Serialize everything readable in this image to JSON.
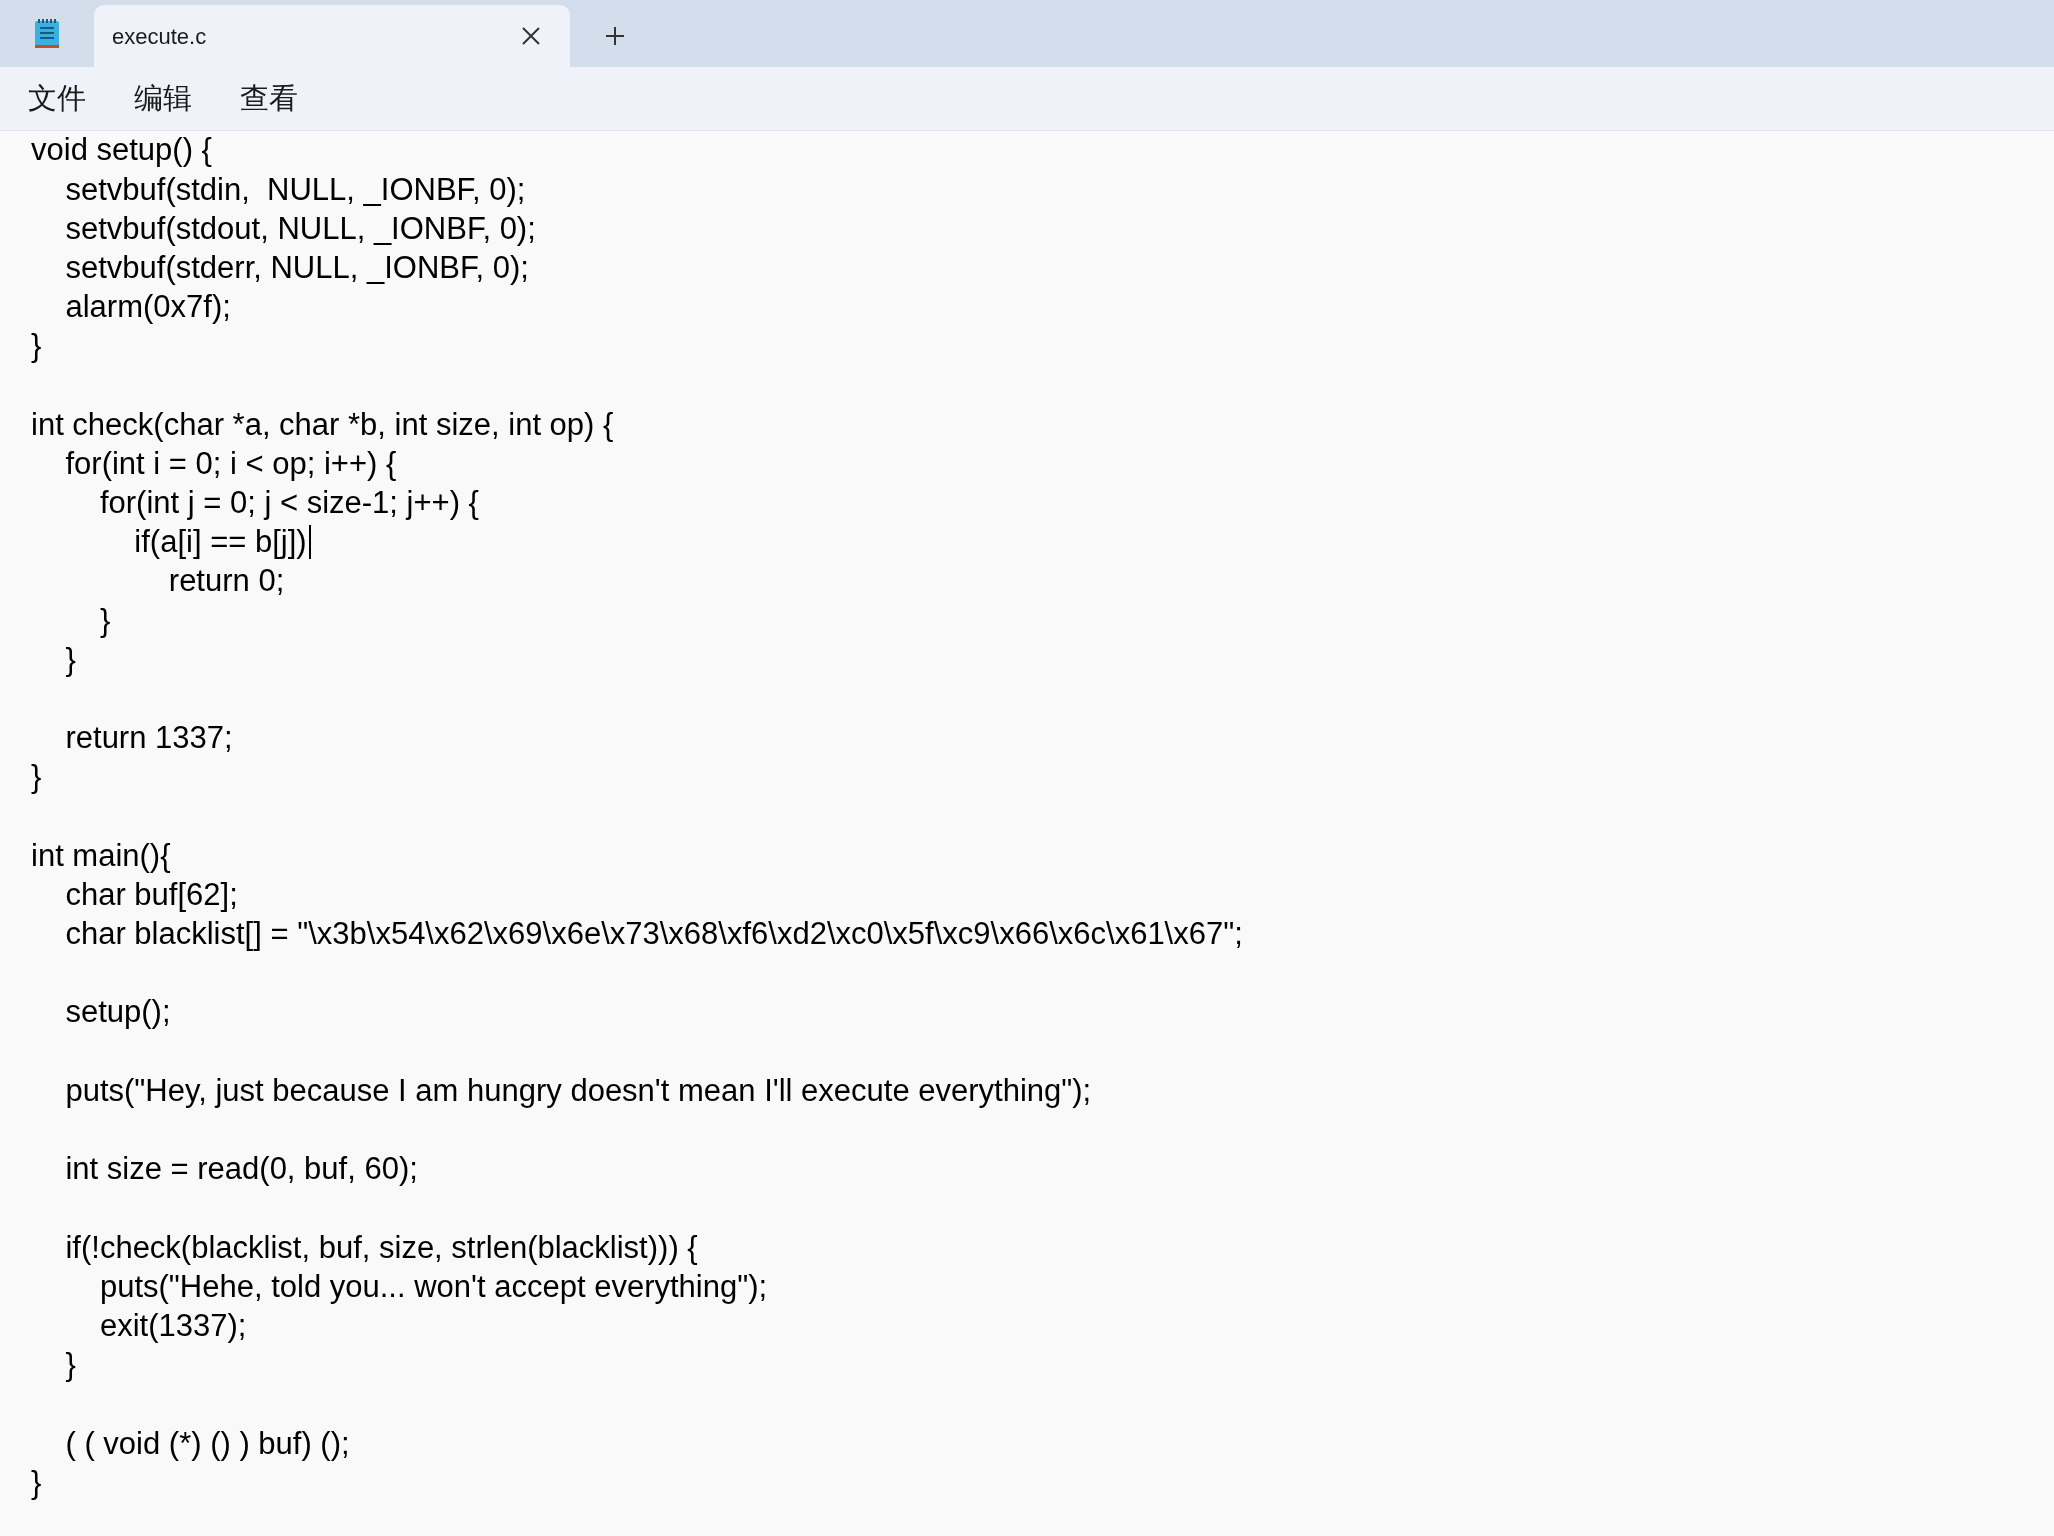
{
  "tabs": [
    {
      "label": "execute.c",
      "selected": true
    }
  ],
  "menu": [
    "文件",
    "编辑",
    "查看"
  ],
  "lines": [
    {
      "text": "void setup() {"
    },
    {
      "text": "    setvbuf(stdin,  NULL, _IONBF, 0);"
    },
    {
      "text": "    setvbuf(stdout, NULL, _IONBF, 0);"
    },
    {
      "text": "    setvbuf(stderr, NULL, _IONBF, 0);"
    },
    {
      "text": "    alarm(0x7f);"
    },
    {
      "text": "}"
    },
    {
      "text": "int check(char *a, char *b, int size, int op) {",
      "blank_line_before": true
    },
    {
      "text": "    for(int i = 0; i < op; i++) {"
    },
    {
      "text": "        for(int j = 0; j < size-1; j++) {"
    },
    {
      "text": "            if(a[i] == b[j])",
      "caret": true
    },
    {
      "text": "                return 0;"
    },
    {
      "text": "        }"
    },
    {
      "text": "    }"
    },
    {
      "text": "    return 1337;",
      "blank_line_before": true
    },
    {
      "text": "}"
    },
    {
      "text": "int main(){",
      "blank_line_before": true
    },
    {
      "text": "    char buf[62];"
    },
    {
      "text": "    char blacklist[] = \"\\x3b\\x54\\x62\\x69\\x6e\\x73\\x68\\xf6\\xd2\\xc0\\x5f\\xc9\\x66\\x6c\\x61\\x67\";"
    },
    {
      "text": "    setup();",
      "blank_line_before": true
    },
    {
      "text": "    puts(\"Hey, just because I am hungry doesn't mean I'll execute everything\");",
      "blank_line_before": true
    },
    {
      "text": "    int size = read(0, buf, 60);",
      "blank_line_before": true
    },
    {
      "text": "    if(!check(blacklist, buf, size, strlen(blacklist))) {",
      "blank_line_before": true
    },
    {
      "text": "        puts(\"Hehe, told you... won't accept everything\");"
    },
    {
      "text": "        exit(1337);"
    },
    {
      "text": "    }"
    },
    {
      "text": "    ( ( void (*) () ) buf) ();",
      "blank_line_before": true
    },
    {
      "text": "}"
    }
  ]
}
